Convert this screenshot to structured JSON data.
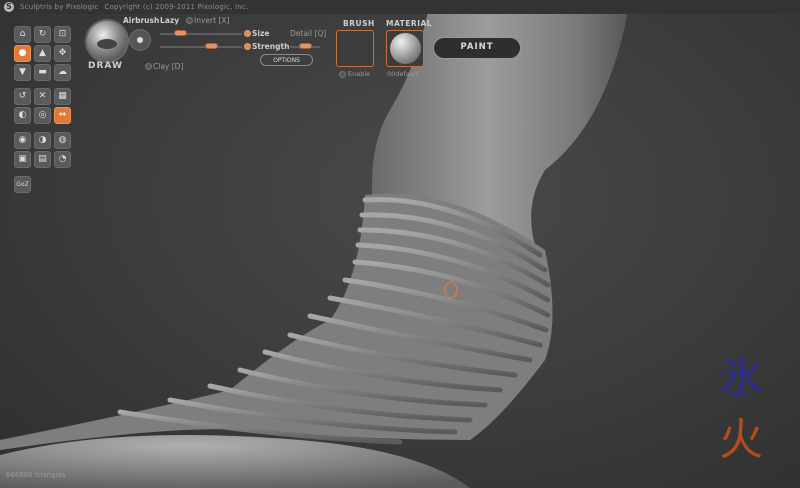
{
  "app": {
    "title": "Sculptris by Pixologic",
    "copyright": "Copyright (c) 2009-2011 Pixologic, Inc.",
    "logo_glyph": "S"
  },
  "toolbar": {
    "brush_name": "DRAW",
    "airbrush_label": "Airbrush",
    "lazy_label": "Lazy",
    "invert_label": "Invert [X]",
    "clay_label": "Clay [D]",
    "size_label": "Size",
    "strength_label": "Strength",
    "detail_label": "Detail [Q]",
    "options_label": "OPTIONS",
    "size_value": 0.2,
    "strength_value": 0.65,
    "detail_value": 0.5
  },
  "brush_panel": {
    "title": "BRUSH",
    "enable_label": "Enable"
  },
  "material_panel": {
    "title": "MATERIAL",
    "name": "00default"
  },
  "paint_button": "PAINT",
  "tools": {
    "rows": [
      [
        "⌂",
        "↻",
        "⊡"
      ],
      [
        "●",
        "▲",
        "✥"
      ],
      [
        "▼",
        "▬",
        "☁"
      ],
      [
        "↺",
        "✕",
        "▦"
      ],
      [
        "◐",
        "◎",
        "⇔"
      ],
      [
        "◉",
        "◑",
        "◍"
      ],
      [
        "▣",
        "▤",
        "◔"
      ]
    ],
    "gdz_label": "GoZ",
    "active_icon": "orange"
  },
  "status": {
    "triangles": "666666 triangles"
  },
  "emblem": {
    "top_glyph": "氷",
    "bottom_glyph": "火",
    "top_color": "#2a2aa0",
    "bottom_color": "#c0501a"
  },
  "colors": {
    "accent": "#e07a3a",
    "background": "#3a3a3a"
  }
}
